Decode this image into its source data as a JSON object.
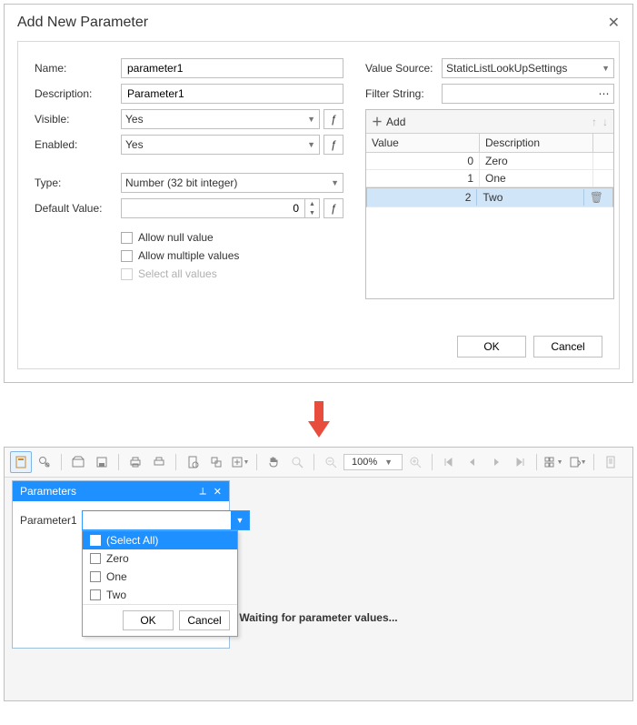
{
  "dialog": {
    "title": "Add New Parameter",
    "labels": {
      "name": "Name:",
      "description": "Description:",
      "visible": "Visible:",
      "enabled": "Enabled:",
      "type": "Type:",
      "default_value": "Default Value:",
      "value_source": "Value Source:",
      "filter_string": "Filter String:"
    },
    "values": {
      "name": "parameter1",
      "description": "Parameter1",
      "visible": "Yes",
      "enabled": "Yes",
      "type": "Number (32 bit integer)",
      "default_value": "0",
      "value_source": "StaticListLookUpSettings",
      "filter_string": ""
    },
    "checkboxes": {
      "allow_null": "Allow null value",
      "allow_multiple": "Allow multiple values",
      "select_all": "Select all values"
    },
    "grid": {
      "add_label": "Add",
      "col_value": "Value",
      "col_description": "Description",
      "rows": [
        {
          "value": "0",
          "description": "Zero"
        },
        {
          "value": "1",
          "description": "One"
        },
        {
          "value": "2",
          "description": "Two"
        }
      ]
    },
    "buttons": {
      "ok": "OK",
      "cancel": "Cancel"
    }
  },
  "viewer": {
    "zoom": "100%",
    "panel_title": "Parameters",
    "param_label": "Parameter1",
    "dropdown": {
      "select_all": "(Select All)",
      "items": [
        "Zero",
        "One",
        "Two"
      ],
      "ok": "OK",
      "cancel": "Cancel"
    },
    "waiting": "Waiting for parameter values..."
  }
}
